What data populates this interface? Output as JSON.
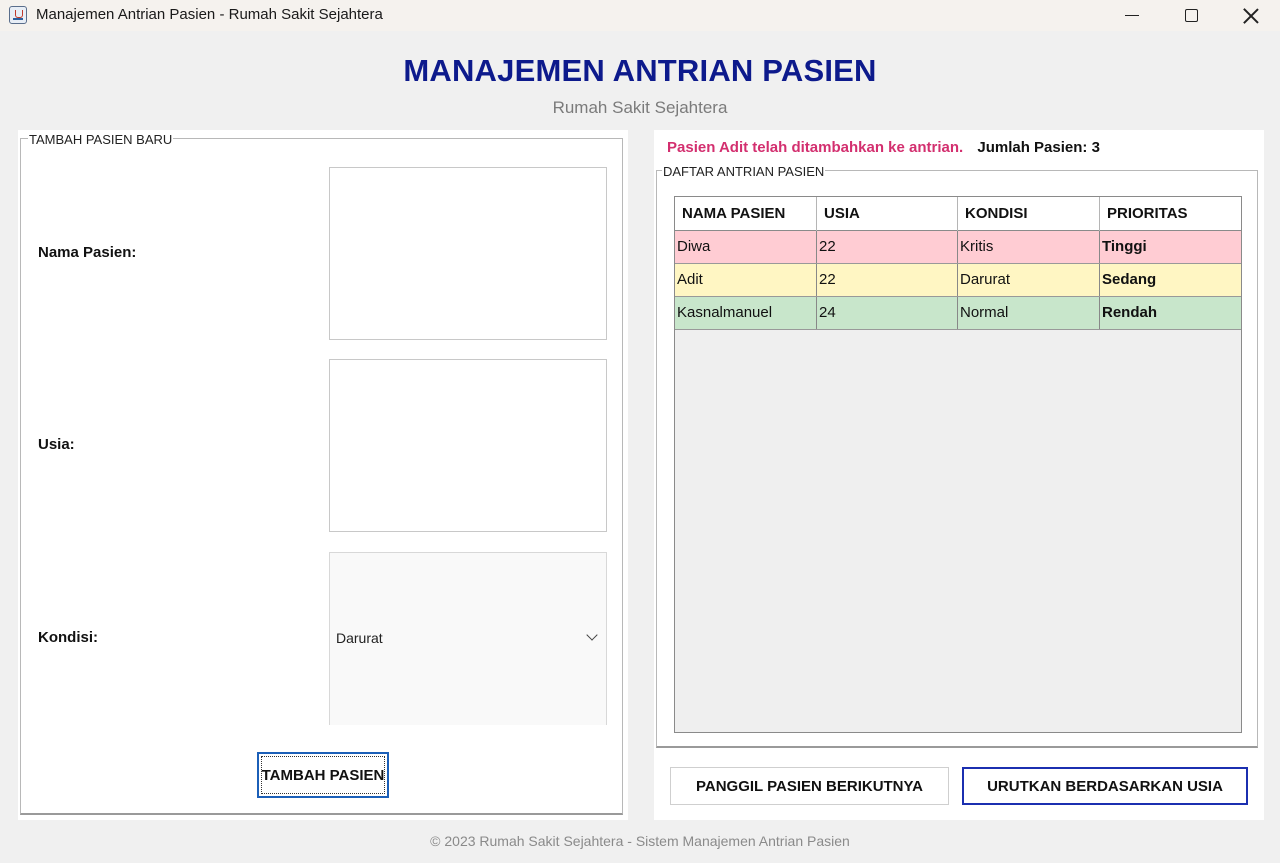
{
  "window": {
    "title": "Manajemen Antrian Pasien - Rumah Sakit Sejahtera",
    "icon": "java-cup-icon"
  },
  "header": {
    "title": "MANAJEMEN ANTRIAN PASIEN",
    "subtitle": "Rumah Sakit Sejahtera"
  },
  "form": {
    "legend": "TAMBAH PASIEN BARU",
    "name_label": "Nama Pasien:",
    "name_value": "",
    "age_label": "Usia:",
    "age_value": "",
    "condition_label": "Kondisi:",
    "condition_value": "Darurat",
    "add_button": "TAMBAH PASIEN"
  },
  "status": {
    "message": "Pasien Adit telah ditambahkan ke antrian.",
    "count": "Jumlah Pasien: 3"
  },
  "queue": {
    "legend": "DAFTAR ANTRIAN PASIEN",
    "columns": [
      "NAMA PASIEN",
      "USIA",
      "KONDISI",
      "PRIORITAS"
    ],
    "rows": [
      {
        "name": "Diwa",
        "age": "22",
        "condition": "Kritis",
        "priority": "Tinggi",
        "color": "#ffccd3"
      },
      {
        "name": "Adit",
        "age": "22",
        "condition": "Darurat",
        "priority": "Sedang",
        "color": "#fff6c3"
      },
      {
        "name": "Kasnalmanuel",
        "age": "24",
        "condition": "Normal",
        "priority": "Rendah",
        "color": "#c8e6cb"
      }
    ]
  },
  "buttons": {
    "next": "PANGGIL PASIEN BERIKUTNYA",
    "sort": "URUTKAN BERDASARKAN USIA"
  },
  "footer": "© 2023 Rumah Sakit Sejahtera - Sistem Manajemen Antrian Pasien",
  "colors": {
    "title": "#0d1a8c",
    "status_message": "#d32f6f",
    "accent_border": "#1b2fb0"
  }
}
